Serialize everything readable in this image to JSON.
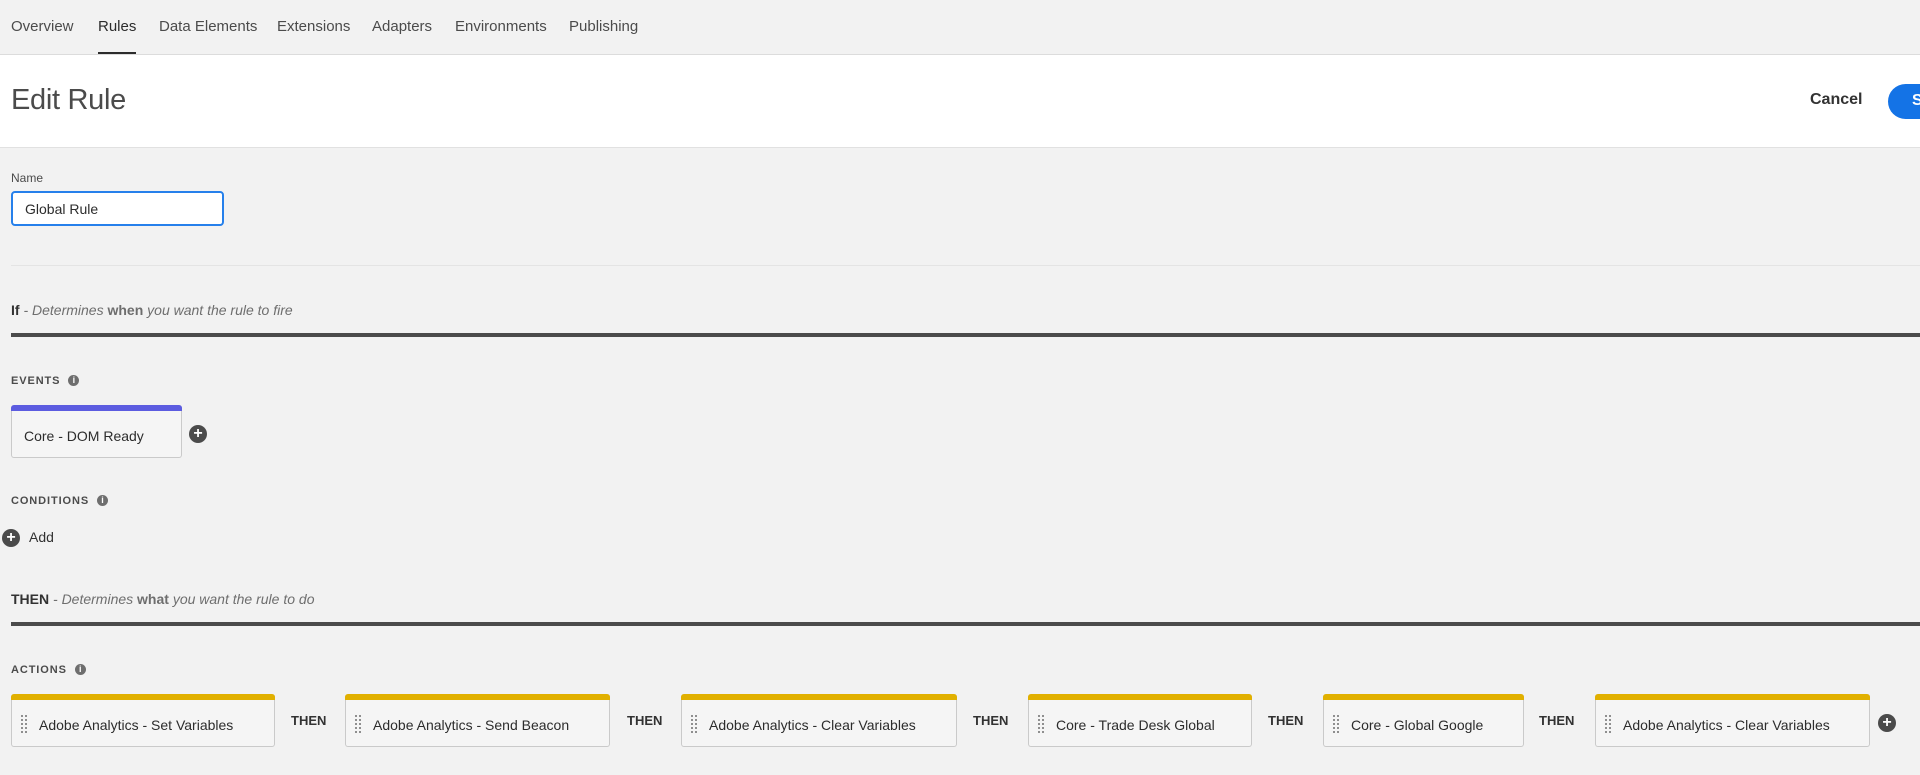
{
  "nav": {
    "tabs": [
      {
        "label": "Overview"
      },
      {
        "label": "Rules",
        "active": true
      },
      {
        "label": "Data Elements"
      },
      {
        "label": "Extensions"
      },
      {
        "label": "Adapters"
      },
      {
        "label": "Environments"
      },
      {
        "label": "Publishing"
      }
    ]
  },
  "header": {
    "title": "Edit Rule",
    "cancel_label": "Cancel",
    "save_label": "S"
  },
  "name_field": {
    "label": "Name",
    "value": "Global Rule"
  },
  "if_section": {
    "keyword": "If",
    "prefix": " - Determines ",
    "emphasis": "when",
    "suffix": " you want the rule to fire"
  },
  "events": {
    "label": "EVENTS",
    "info_icon": "info-icon",
    "items": [
      {
        "label": "Core - DOM Ready"
      }
    ],
    "add_icon": "plus-circle-icon"
  },
  "conditions": {
    "label": "CONDITIONS",
    "info_icon": "info-icon",
    "add_label": "Add",
    "add_icon": "plus-circle-icon"
  },
  "then_section": {
    "keyword": "THEN",
    "prefix": " - Determines ",
    "emphasis": "what",
    "suffix": " you want the rule to do"
  },
  "actions": {
    "label": "ACTIONS",
    "info_icon": "info-icon",
    "separator_label": "THEN",
    "items": [
      {
        "label": "Adobe Analytics - Set Variables"
      },
      {
        "label": "Adobe Analytics - Send Beacon"
      },
      {
        "label": "Adobe Analytics - Clear Variables"
      },
      {
        "label": "Core - Trade Desk Global"
      },
      {
        "label": "Core - Global Google"
      },
      {
        "label": "Adobe Analytics - Clear Variables"
      }
    ],
    "add_icon": "plus-circle-icon"
  },
  "colors": {
    "event_bar": "#5c5ce0",
    "action_bar": "#e1b000",
    "primary_button": "#1473e6",
    "input_focus": "#2680eb"
  }
}
